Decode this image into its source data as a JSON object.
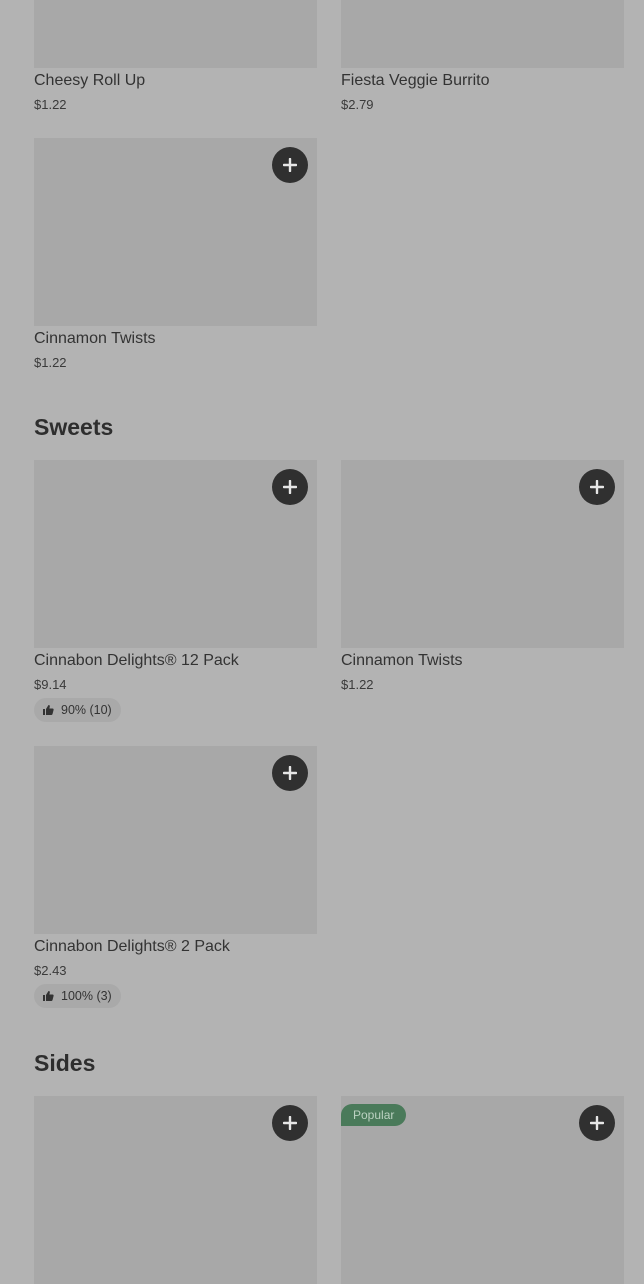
{
  "items_top": [
    {
      "name": "Cheesy Roll Up",
      "price": "$1.22"
    },
    {
      "name": "Fiesta Veggie Burrito",
      "price": "$2.79"
    },
    {
      "name": "Cinnamon Twists",
      "price": "$1.22"
    }
  ],
  "sections": {
    "sweets": "Sweets",
    "sides": "Sides"
  },
  "sweets": [
    {
      "name": "Cinnabon Delights® 12 Pack",
      "price": "$9.14",
      "rating": "90% (10)"
    },
    {
      "name": "Cinnamon Twists",
      "price": "$1.22"
    },
    {
      "name": "Cinnabon Delights® 2 Pack",
      "price": "$2.43",
      "rating": "100% (3)"
    }
  ],
  "sides_badge": "Popular",
  "icons": {
    "add": "plus-icon",
    "rating": "thumbs-up-icon"
  },
  "colors": {
    "background": "#b3b3b3",
    "button": "#303030",
    "badge": "#4a7a5a"
  }
}
